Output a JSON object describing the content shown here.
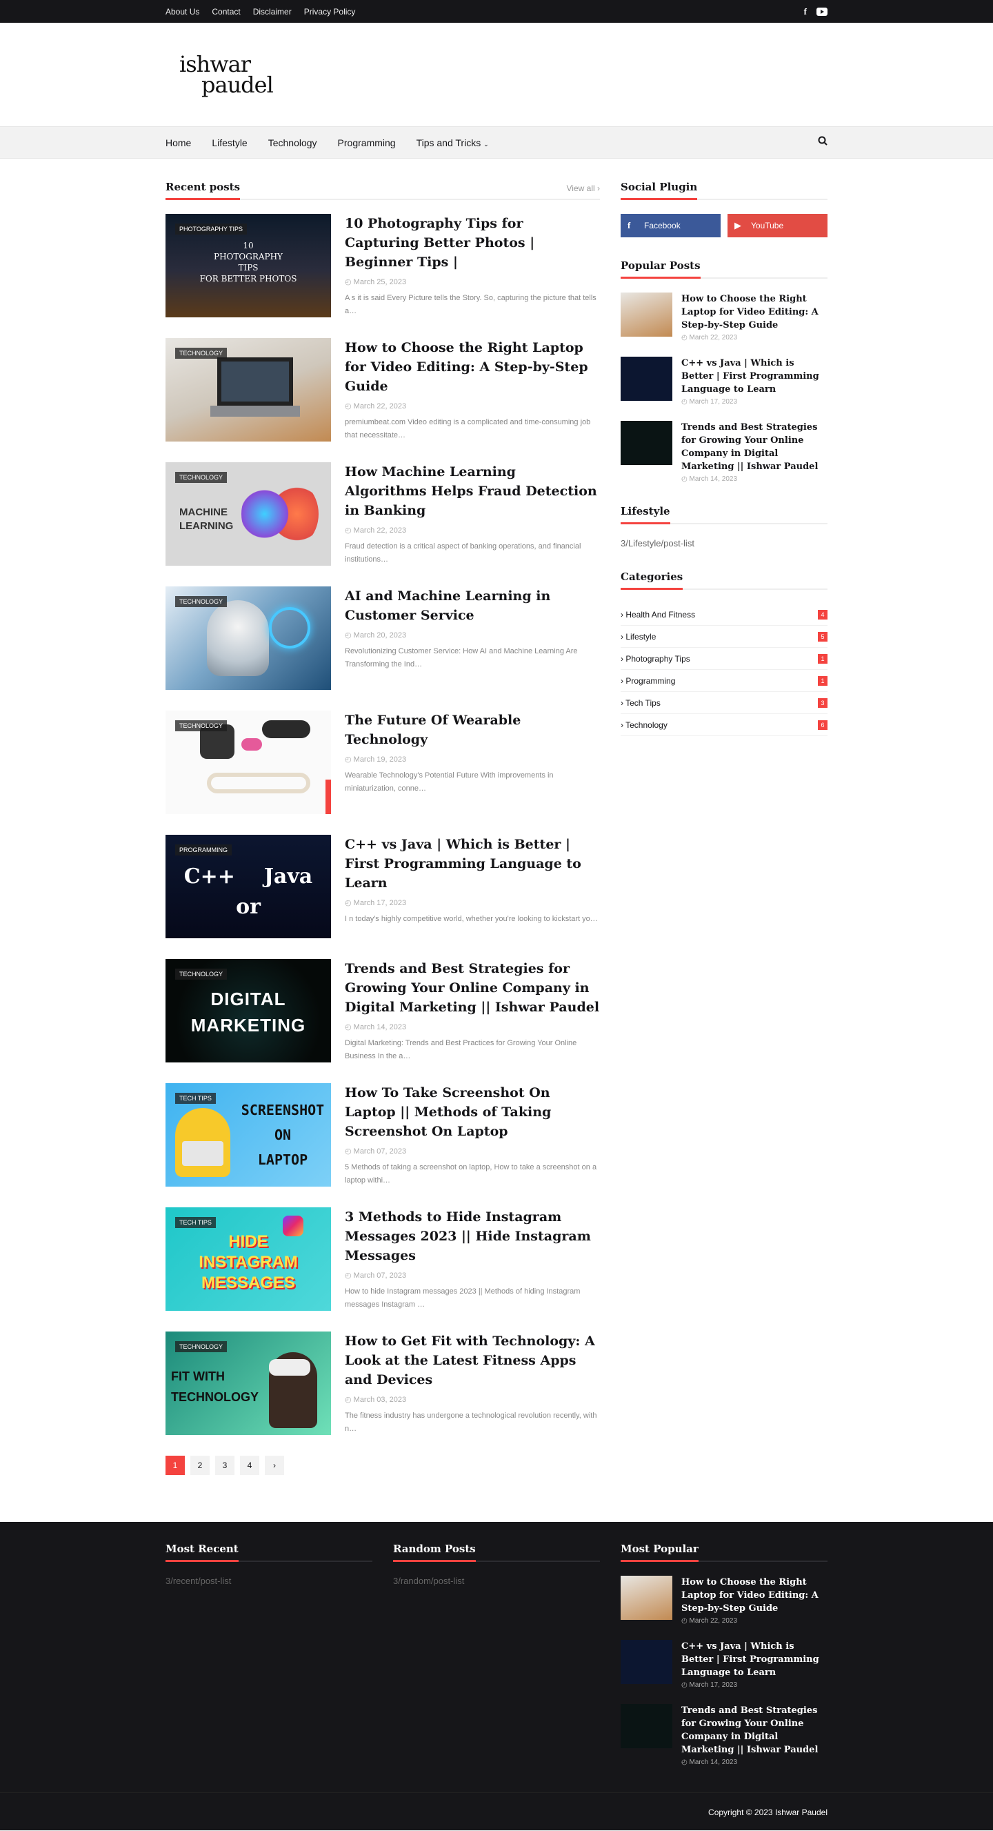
{
  "topbar": {
    "links": [
      "About Us",
      "Contact",
      "Disclaimer",
      "Privacy Policy"
    ]
  },
  "logo": {
    "line1": "ishwar",
    "line2": "paudel"
  },
  "nav": {
    "items": [
      "Home",
      "Lifestyle",
      "Technology",
      "Programming",
      "Tips and Tricks"
    ]
  },
  "recent": {
    "title": "Recent posts",
    "view_all": "View all"
  },
  "posts": [
    {
      "tag": "Photography Tips",
      "title": "10 Photography Tips for Capturing Better Photos | Beginner Tips |",
      "date": "March 25, 2023",
      "snippet": "A s it is said Every Picture tells the Story. So, capturing the picture that tells a…",
      "art": "10\nPHOTOGRAPHY\nTIPS\nFOR BETTER PHOTOS"
    },
    {
      "tag": "Technology",
      "title": "How to Choose the Right Laptop for Video Editing: A Step-by-Step Guide",
      "date": "March 22, 2023",
      "snippet": "premiumbeat.com Video editing is a complicated and time-consuming job that necessitate…",
      "art": ""
    },
    {
      "tag": "Technology",
      "title": "How Machine Learning Algorithms Helps Fraud Detection in Banking",
      "date": "March 22, 2023",
      "snippet": "Fraud detection is a critical aspect of banking operations, and financial institutions…",
      "art": "MACHINE\nLEARNING"
    },
    {
      "tag": "Technology",
      "title": "AI and Machine Learning in Customer Service",
      "date": "March 20, 2023",
      "snippet": "Revolutionizing Customer Service: How AI and Machine Learning Are Transforming the Ind…",
      "art": ""
    },
    {
      "tag": "Technology",
      "title": "The Future Of Wearable Technology",
      "date": "March 19, 2023",
      "snippet": "Wearable Technology's Potential Future With improvements in miniaturization, conne…",
      "art": ""
    },
    {
      "tag": "Programming",
      "title": "C++ vs Java | Which is Better | First Programming Language to Learn",
      "date": "March 17, 2023",
      "snippet": "I n today's highly competitive world, whether you're looking to kickstart yo…",
      "art": "C++    Java\nor"
    },
    {
      "tag": "Technology",
      "title": "Trends and Best Strategies for Growing Your Online Company in Digital Marketing || Ishwar Paudel",
      "date": "March 14, 2023",
      "snippet": "Digital Marketing: Trends and Best Practices for Growing Your Online Business In the a…",
      "art": "DIGITAL\nMARKETING"
    },
    {
      "tag": "Tech Tips",
      "title": "How To Take Screenshot On Laptop || Methods of Taking Screenshot On Laptop",
      "date": "March 07, 2023",
      "snippet": "5 Methods of taking a screenshot on laptop, How to take a screenshot on a laptop withi…",
      "art": "SCREENSHOT\nON\nLAPTOP"
    },
    {
      "tag": "Tech Tips",
      "title": "3 Methods to Hide Instagram Messages 2023 || Hide Instagram Messages",
      "date": "March 07, 2023",
      "snippet": "How to hide Instagram messages 2023 || Methods of hiding Instagram messages Instagram …",
      "art": "HIDE\nINSTAGRAM\nMESSAGES"
    },
    {
      "tag": "Technology",
      "title": "How to Get Fit with Technology: A Look at the Latest Fitness Apps and Devices",
      "date": "March 03, 2023",
      "snippet": "The fitness industry has undergone a technological revolution recently, with n…",
      "art": "FIT WITH\nTECHNOLOGY"
    }
  ],
  "pager": [
    "1",
    "2",
    "3",
    "4",
    "›"
  ],
  "sidebar": {
    "social_title": "Social Plugin",
    "facebook": "Facebook",
    "youtube": "YouTube",
    "popular_title": "Popular Posts",
    "popular": [
      {
        "title": "How to Choose the Right Laptop for Video Editing: A Step-by-Step Guide",
        "date": "March 22, 2023"
      },
      {
        "title": "C++ vs Java | Which is Better | First Programming Language to Learn",
        "date": "March 17, 2023"
      },
      {
        "title": "Trends and Best Strategies for Growing Your Online Company in Digital Marketing || Ishwar Paudel",
        "date": "March 14, 2023"
      }
    ],
    "lifestyle_title": "Lifestyle",
    "lifestyle_text": "3/Lifestyle/post-list",
    "categories_title": "Categories",
    "categories": [
      {
        "name": "Health And Fitness",
        "count": "4"
      },
      {
        "name": "Lifestyle",
        "count": "5"
      },
      {
        "name": "Photography Tips",
        "count": "1"
      },
      {
        "name": "Programming",
        "count": "1"
      },
      {
        "name": "Tech Tips",
        "count": "3"
      },
      {
        "name": "Technology",
        "count": "6"
      }
    ]
  },
  "footer": {
    "most_recent": "Most Recent",
    "most_recent_text": "3/recent/post-list",
    "random": "Random Posts",
    "random_text": "3/random/post-list",
    "most_popular": "Most Popular",
    "copyright": "Copyright © 2023 Ishwar Paudel"
  },
  "colors": {
    "accent": "#f4433f",
    "dark": "#161619",
    "facebook": "#3b5999",
    "youtube": "#e24c44"
  }
}
